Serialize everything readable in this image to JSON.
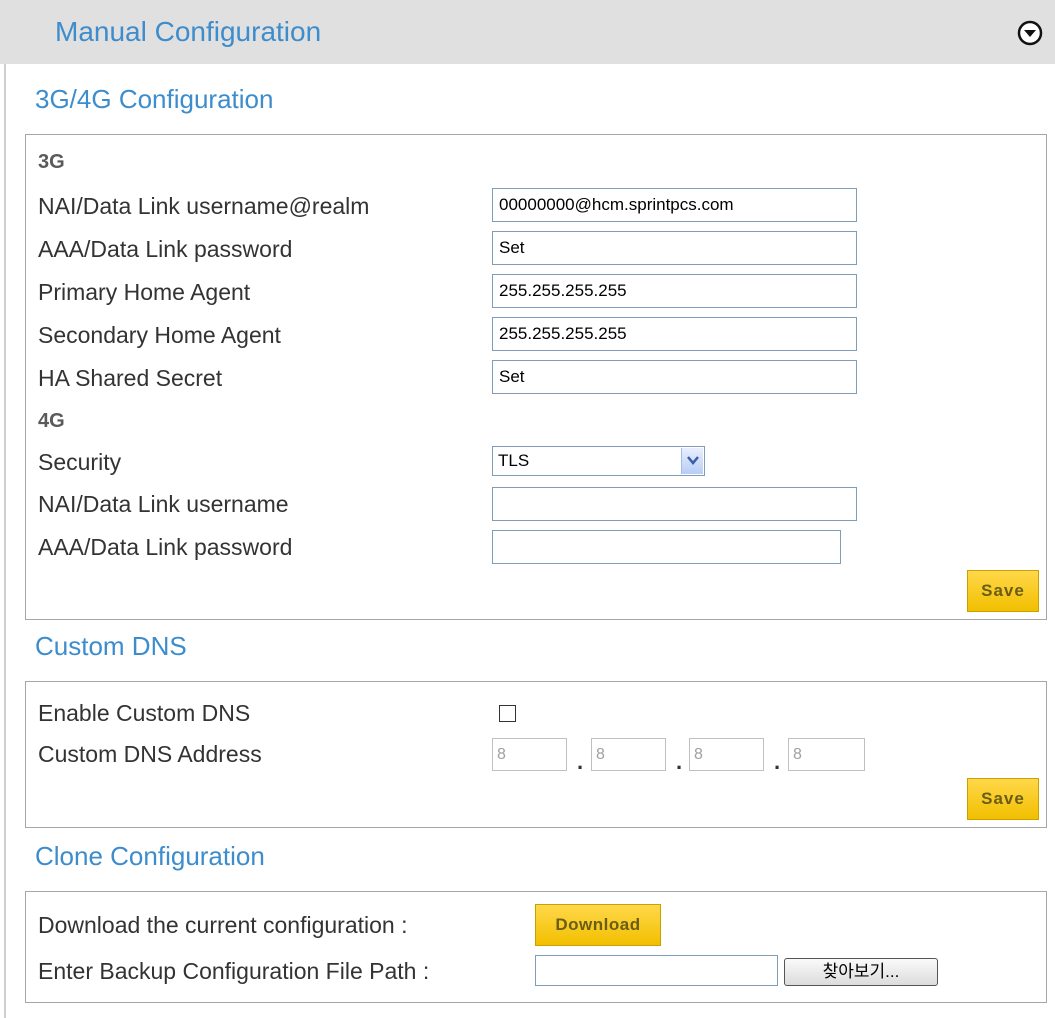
{
  "header": {
    "title": "Manual Configuration"
  },
  "sections": {
    "config": {
      "title": "3G/4G Configuration",
      "g3_heading": "3G",
      "nai_realm_label": "NAI/Data Link username@realm",
      "nai_realm_value": "00000000@hcm.sprintpcs.com",
      "aaa_pw_label": "AAA/Data Link password",
      "aaa_pw_value": "Set",
      "primary_ha_label": "Primary Home Agent",
      "primary_ha_value": "255.255.255.255",
      "secondary_ha_label": "Secondary Home Agent",
      "secondary_ha_value": "255.255.255.255",
      "ha_secret_label": "HA Shared Secret",
      "ha_secret_value": "Set",
      "g4_heading": "4G",
      "security_label": "Security",
      "security_value": "TLS",
      "nai_user_label": "NAI/Data Link username",
      "nai_user_value": "",
      "aaa_pw4_label": "AAA/Data Link password",
      "aaa_pw4_value": "",
      "save_label": "Save"
    },
    "dns": {
      "title": "Custom DNS",
      "enable_label": "Enable Custom DNS",
      "enable_checked": false,
      "address_label": "Custom DNS Address",
      "octets": [
        "8",
        "8",
        "8",
        "8"
      ],
      "save_label": "Save"
    },
    "clone": {
      "title": "Clone Configuration",
      "download_label": "Download the current configuration :",
      "download_button": "Download",
      "backup_label": "Enter Backup Configuration File Path :",
      "backup_value": "",
      "browse_button": "찾아보기..."
    }
  },
  "colors": {
    "section_title": "#3d8ccc",
    "header_bg": "#e0e0e0",
    "button_gold": "#f2bf00"
  }
}
